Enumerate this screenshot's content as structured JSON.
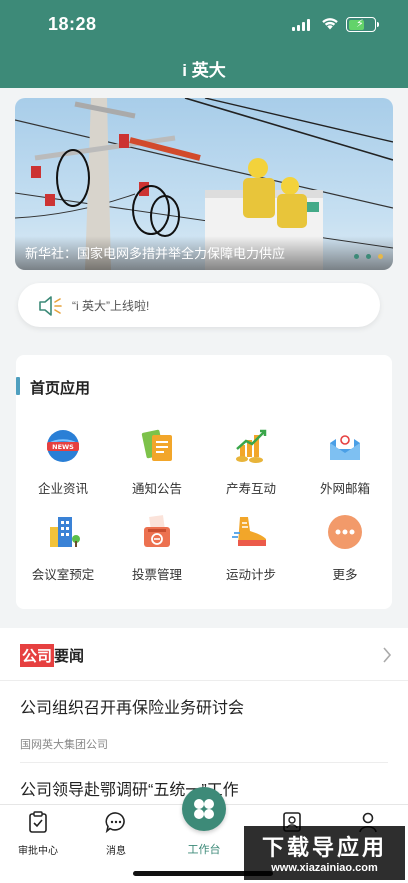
{
  "status_bar": {
    "time": "18:28"
  },
  "header": {
    "title": "i 英大"
  },
  "banner": {
    "caption": "新华社：国家电网多措并举全力保障电力供应",
    "slides": 3,
    "active_slide": 3
  },
  "notice": {
    "text": "“i 英大”上线啦!"
  },
  "apps": {
    "title": "首页应用",
    "items": [
      {
        "label": "企业资讯",
        "icon": "news-icon"
      },
      {
        "label": "通知公告",
        "icon": "notice-icon"
      },
      {
        "label": "产寿互动",
        "icon": "coins-chart-icon"
      },
      {
        "label": "外网邮箱",
        "icon": "mail-icon"
      },
      {
        "label": "会议室预定",
        "icon": "building-icon"
      },
      {
        "label": "投票管理",
        "icon": "ballot-box-icon"
      },
      {
        "label": "运动计步",
        "icon": "sneaker-icon"
      },
      {
        "label": "更多",
        "icon": "more-icon"
      }
    ]
  },
  "news": {
    "tag": "公司",
    "title_rest": "要闻",
    "items": [
      {
        "title": "公司组织召开再保险业务研讨会",
        "source": "国网英大集团公司"
      },
      {
        "title": "公司领导赴鄂调研“五统一”工作"
      }
    ]
  },
  "tabbar": {
    "tabs": [
      {
        "label": "审批中心",
        "icon": "clipboard-check-icon"
      },
      {
        "label": "消息",
        "icon": "chat-icon"
      },
      {
        "label": "工作台",
        "icon": "clover-icon"
      },
      {
        "label": "",
        "icon": "contacts-icon"
      },
      {
        "label": "",
        "icon": "user-icon"
      }
    ]
  },
  "watermark": {
    "line1": "下载导应用",
    "line2": "www.xiazainiao.com"
  },
  "colors": {
    "brand": "#3d8a78",
    "accent_red": "#e64040",
    "dot_active": "#e6b84a"
  }
}
